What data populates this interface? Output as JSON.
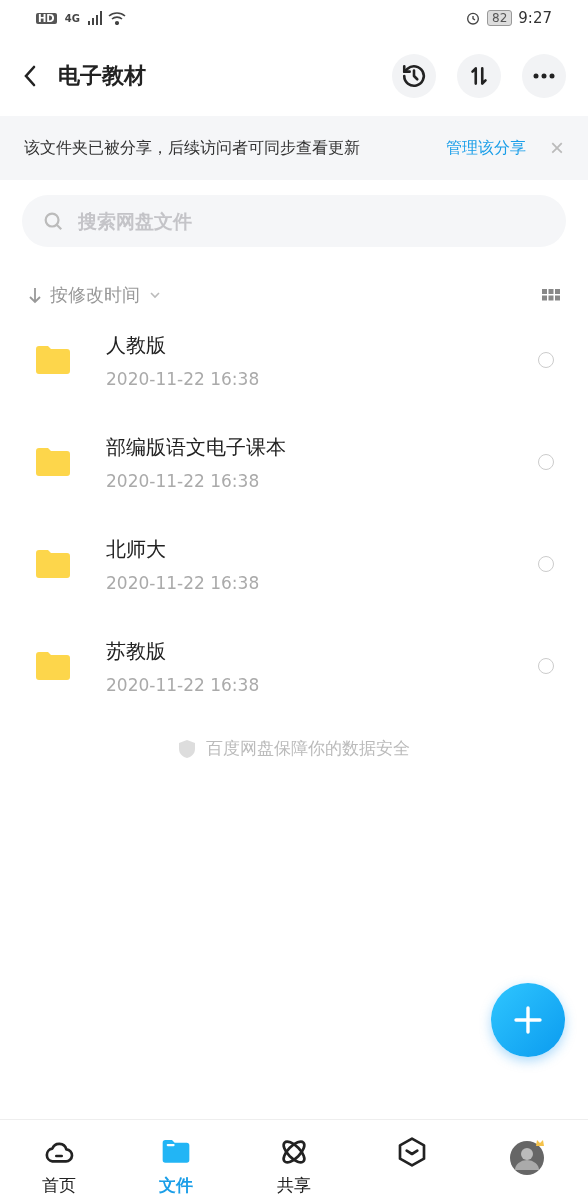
{
  "status_bar": {
    "left": [
      "HD",
      "4G"
    ],
    "battery": "82",
    "time": "9:27"
  },
  "header": {
    "title": "电子教材"
  },
  "share_notice": {
    "text": "该文件夹已被分享，后续访问者可同步查看更新",
    "action": "管理该分享",
    "close": "×"
  },
  "search": {
    "placeholder": "搜索网盘文件"
  },
  "sort": {
    "label": "按修改时间"
  },
  "files": [
    {
      "name": "人教版",
      "date": "2020-11-22  16:38",
      "selected": false
    },
    {
      "name": "部编版语文电子课本",
      "date": "2020-11-22  16:38",
      "selected": false
    },
    {
      "name": "北师大",
      "date": "2020-11-22  16:38",
      "selected": false
    },
    {
      "name": "苏教版",
      "date": "2020-11-22  16:38",
      "selected": false
    }
  ],
  "footer_note": "百度网盘保障你的数据安全",
  "tabs": [
    {
      "kind": "cloud",
      "label": "首页",
      "selected": false
    },
    {
      "kind": "folder",
      "label": "文件",
      "selected": true
    },
    {
      "kind": "atom",
      "label": "共享",
      "selected": false
    },
    {
      "kind": "cube",
      "selected": false
    },
    {
      "kind": "avatar",
      "selected": false
    }
  ]
}
